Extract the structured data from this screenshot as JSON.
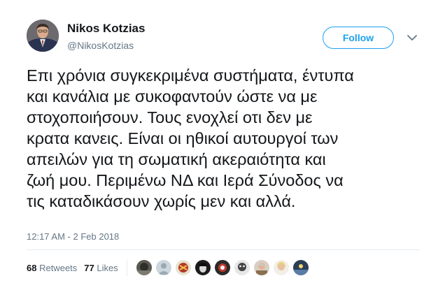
{
  "author": {
    "name": "Nikos Kotzias",
    "handle": "@NikosKotzias"
  },
  "follow_label": "Follow",
  "tweet_lines": [
    "Επι χρόνια συγκεκριμένα συστήματα, έντυπα",
    "και κανάλια με συκοφαντούν ώστε να με",
    "στοχοποιήσουν. Τους ενοχλεί οτι δεν με",
    "κρατα κανεις. Είναι οι ηθικοί αυτουργοί των",
    "απειλών για τη σωματική ακεραιότητα και",
    "ζωή μου. Περιμένω ΝΔ και Ιερά Σύνοδος να",
    "τις καταδικάσουν χωρίς μεν και αλλά."
  ],
  "timestamp": "12:17 AM - 2 Feb 2018",
  "stats": {
    "retweets_count": "68",
    "retweets_label": "Retweets",
    "likes_count": "77",
    "likes_label": "Likes"
  },
  "colors": {
    "accent": "#1da1f2",
    "secondary_text": "#657786",
    "divider": "#e6ecf0"
  },
  "icons": {
    "menu": "chevron-down-icon"
  }
}
